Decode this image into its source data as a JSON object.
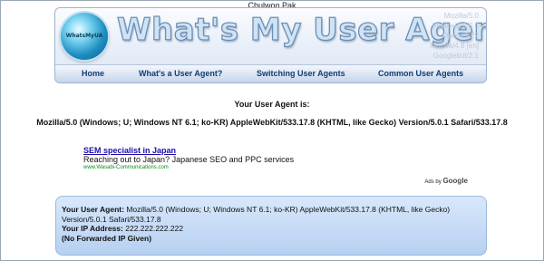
{
  "author": "Chulwoo Pak",
  "header": {
    "logo_badge": "WhatsMyUA",
    "title": "What's My User Agent?",
    "agents": [
      "Mozilla/5.0",
      "Firefox/2.0.0.6",
      "Opera/9.22",
      "Mozilla/4.8 [en]",
      "Googlebot/2.1"
    ]
  },
  "nav": {
    "items": [
      {
        "label": "Home"
      },
      {
        "label": "What's a User Agent?"
      },
      {
        "label": "Switching User Agents"
      },
      {
        "label": "Common User Agents"
      }
    ]
  },
  "main": {
    "heading": "Your User Agent is:",
    "user_agent": "Mozilla/5.0 (Windows; U; Windows NT 6.1; ko-KR) AppleWebKit/533.17.8 (KHTML, like Gecko) Version/5.0.1 Safari/533.17.8"
  },
  "ad": {
    "title": "SEM specialist in Japan",
    "description": "Reaching out to Japan? Japanese SEO and PPC services",
    "url": "www.Wasabi-Communications.com",
    "ads_by": "Ads by",
    "google": "Google"
  },
  "info": {
    "ua_label": "Your User Agent:",
    "ua_value": "Mozilla/5.0 (Windows; U; Windows NT 6.1; ko-KR) AppleWebKit/533.17.8 (KHTML, like Gecko) Version/5.0.1 Safari/533.17.8",
    "ip_label": "Your IP Address:",
    "ip_value": "222.222.222.222",
    "forwarded": "(No Forwarded IP Given)"
  }
}
